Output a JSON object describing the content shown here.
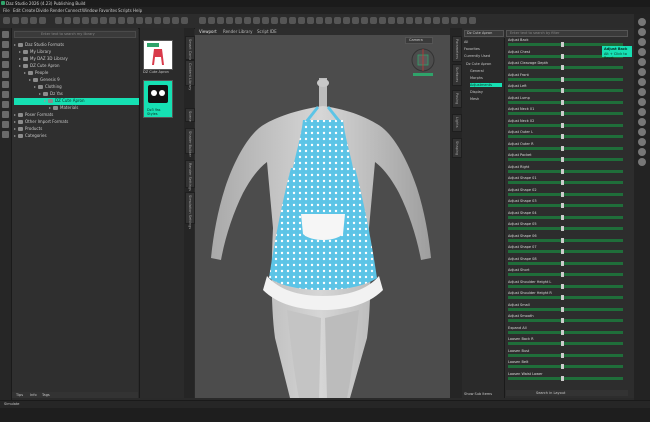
{
  "window": {
    "title": "Daz Studio 2026 (4.23) Publishing Build"
  },
  "menu": [
    "File",
    "Edit",
    "Create",
    "Divide",
    "Render",
    "Connect",
    "Window",
    "Favorites",
    "Scripts",
    "Help"
  ],
  "library": {
    "search_placeholder": "Enter text to search my library",
    "items": [
      {
        "label": "Daz Studio Formats",
        "depth": 0,
        "selected": false
      },
      {
        "label": "My Library",
        "depth": 1,
        "selected": false
      },
      {
        "label": "My DAZ 3D Library",
        "depth": 1,
        "selected": false
      },
      {
        "label": "DZ Cute Apron",
        "depth": 1,
        "selected": false
      },
      {
        "label": "People",
        "depth": 2,
        "selected": false
      },
      {
        "label": "Genesis 9",
        "depth": 3,
        "selected": false
      },
      {
        "label": "Clothing",
        "depth": 4,
        "selected": false
      },
      {
        "label": "Dz Yas",
        "depth": 5,
        "selected": false
      },
      {
        "label": "DZ Cute Apron",
        "depth": 6,
        "selected": true
      },
      {
        "label": "Materials",
        "depth": 7,
        "selected": false
      },
      {
        "label": "Poser Formats",
        "depth": 0,
        "selected": false
      },
      {
        "label": "Other Import Formats",
        "depth": 0,
        "selected": false
      },
      {
        "label": "Products",
        "depth": 0,
        "selected": false
      },
      {
        "label": "Categories",
        "depth": 0,
        "selected": false
      }
    ],
    "footer_tabs": [
      "Tips",
      "Info",
      "Tags"
    ]
  },
  "thumbs": [
    {
      "label": "DZ Cute Apron"
    },
    {
      "label": "Dz3 Yas Styles"
    }
  ],
  "viewport_tabs": [
    "Viewport",
    "Render Library",
    "Script IDE"
  ],
  "camera": "Camera",
  "left_vtabs": [
    "Smart Content",
    "Content Library",
    "Scene",
    "Shader Builder",
    "Render Settings",
    "Simulation Settings",
    "Aux"
  ],
  "right_vtabs": [
    "Parameters",
    "Surfaces",
    "Posing",
    "Lights",
    "Shaping"
  ],
  "params": {
    "header_select": "Dz Cute Apron",
    "search_placeholder": "Enter text to search by filter",
    "filters": [
      "All",
      "Favorites",
      "Currently Used"
    ],
    "tree": [
      "Dz Cute Apron",
      "General",
      "Morphs",
      "Adjustments",
      "Display",
      "Mesh",
      "Scene"
    ],
    "show_sub_items": "Show Sub Items",
    "rows": [
      "Adjust Back",
      "Adjust Chest",
      "Adjust Cleavage Depth",
      "Adjust Front",
      "Adjust Left",
      "Adjust Lump",
      "Adjust Neck 01",
      "Adjust Neck 02",
      "Adjust Outer L",
      "Adjust Outer R",
      "Adjust Pocket",
      "Adjust Right",
      "Adjust Shape 01",
      "Adjust Shape 02",
      "Adjust Shape 03",
      "Adjust Shape 04",
      "Adjust Shape 05",
      "Adjust Shape 06",
      "Adjust Shape 07",
      "Adjust Shape 08",
      "Adjust Short",
      "Adjust Shoulder Height L",
      "Adjust Shoulder Height R",
      "Adjust Small",
      "Adjust Smooth",
      "Expand All",
      "Loosen Back R",
      "Loosen Bust",
      "Loosen Belt",
      "Loosen Waist Lower"
    ],
    "tooltip": {
      "title": "Adjust Back",
      "sub": "Alt + Click to Reset"
    },
    "footer": "Search in Layout"
  },
  "status": {
    "left": "Simulate"
  },
  "colors": {
    "accent": "#16e0b3",
    "apron": "#5cc4e6",
    "dots": "#ffffff",
    "figure": "#c9c9c9"
  }
}
